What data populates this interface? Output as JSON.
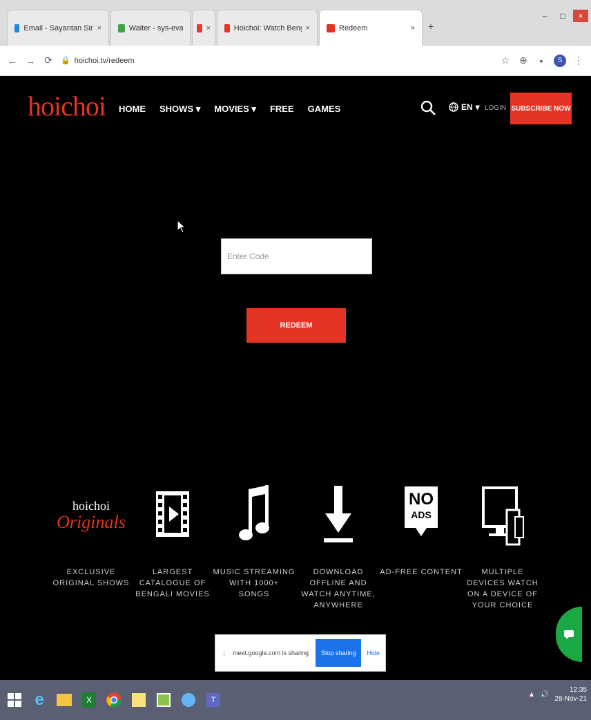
{
  "browser": {
    "tabs": [
      {
        "title": "Email - Sayantan Sinha - Outlook",
        "color": "#1e88e5",
        "active": false
      },
      {
        "title": "Waiter - sys-evaocp",
        "color": "#43a047",
        "active": false
      },
      {
        "title": "",
        "color": "#e53935",
        "active": false
      },
      {
        "title": "Hoichoi: Watch Bengali Movies",
        "color": "#e53324",
        "active": false
      },
      {
        "title": "Redeem",
        "color": "#e53324",
        "active": true
      }
    ],
    "tab_close": "×",
    "new_tab": "+",
    "window_controls": {
      "min": "–",
      "max": "□",
      "close": "×"
    },
    "url": "hoichoi.tv/redeem",
    "profile_initial": "S"
  },
  "site": {
    "logo": "hoichoi",
    "nav": [
      "HOME",
      "SHOWS ▾",
      "MOVIES ▾",
      "FREE",
      "GAMES"
    ],
    "language": "EN",
    "login": "LOGIN",
    "subscribe": "SUBSCRIBE NOW",
    "accent": "#e53324"
  },
  "redeem": {
    "placeholder": "Enter Code",
    "button": "REDEEM"
  },
  "features": [
    {
      "icon": "hoichoi-originals-logo",
      "logo_top": "hoichoi",
      "logo_bottom": "Originals",
      "label": "Exclusive Original Shows"
    },
    {
      "icon": "film-strip-icon",
      "label": "Largest Catalogue of Bengali Movies"
    },
    {
      "icon": "music-note-icon",
      "label": "Music Streaming with 1000+ Songs"
    },
    {
      "icon": "download-icon",
      "label": "Download Offline and Watch Anytime, Anywhere"
    },
    {
      "icon": "no-ads-icon",
      "icon_text_1": "NO",
      "icon_text_2": "ADS",
      "label": "Ad-Free Content"
    },
    {
      "icon": "multiple-devices-icon",
      "label": "Multiple Devices Watch on a Device of Your Choice"
    }
  ],
  "sharing": {
    "text": "meet.google.com is sharing your screen.",
    "stop": "Stop sharing",
    "hide": "Hide"
  },
  "taskbar": {
    "apps": [
      "windows-start-icon",
      "ie-icon",
      "file-explorer-icon",
      "excel-icon",
      "chrome-icon",
      "sticky-notes-icon",
      "paint-icon",
      "network-icon",
      "teams-icon"
    ],
    "time": "12:35",
    "date": "28-Nov-21"
  }
}
